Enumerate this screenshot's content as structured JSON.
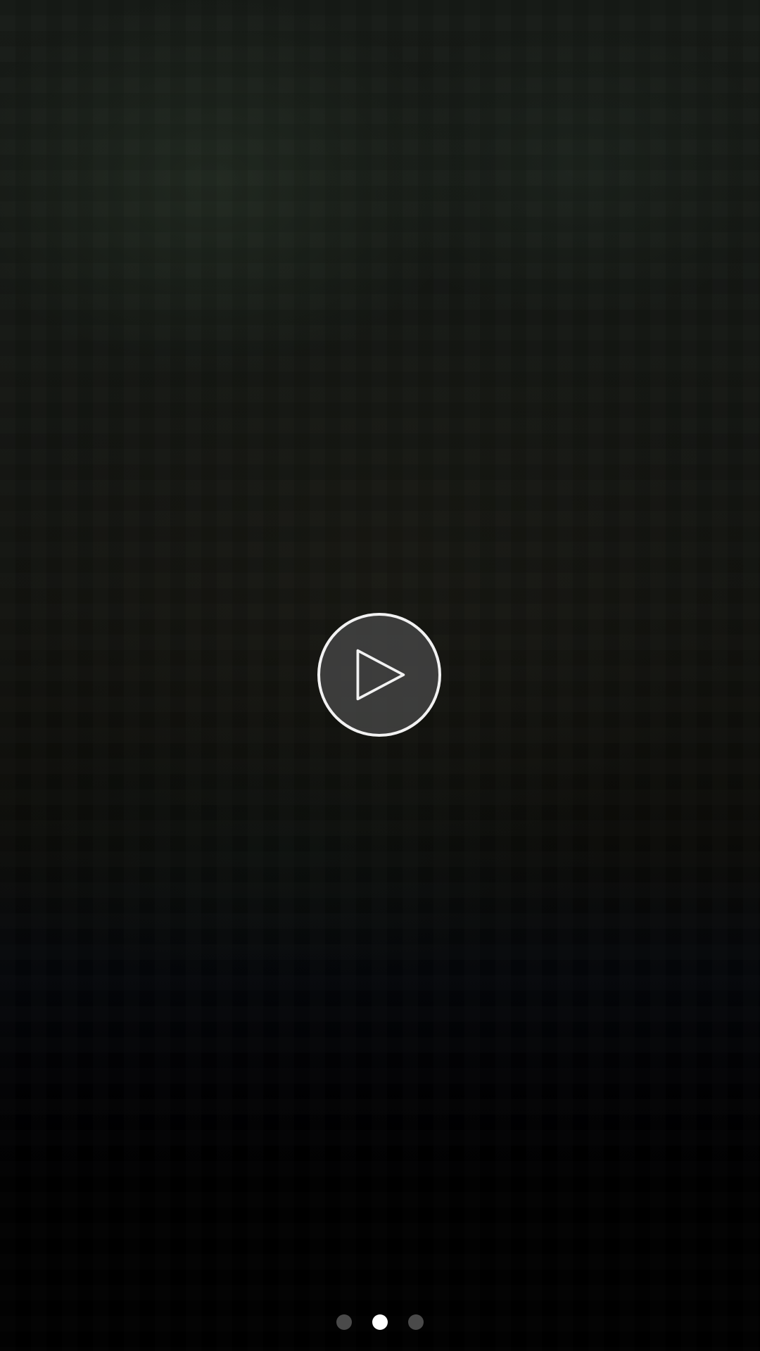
{
  "video": {
    "state": "paused"
  },
  "play_button": {
    "icon": "play-icon"
  },
  "page_indicator": {
    "total_pages": 3,
    "current_page": 2,
    "active_color": "#ffffff",
    "inactive_color": "#4a4a4a"
  }
}
